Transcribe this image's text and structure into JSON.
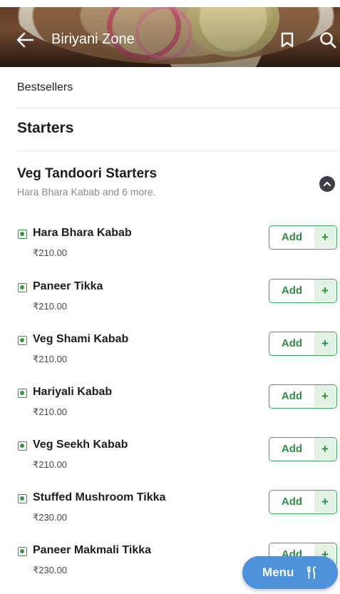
{
  "header": {
    "title": "Biriyani Zone",
    "back_icon": "arrow-left-icon",
    "bookmark_icon": "bookmark-icon",
    "search_icon": "search-icon"
  },
  "nav": {
    "bestsellers": "Bestsellers",
    "starters": "Starters"
  },
  "category": {
    "title": "Veg Tandoori Starters",
    "subtitle": "Hara Bhara Kabab and 6 more.",
    "toggle_icon": "chevron-up-icon"
  },
  "items": [
    {
      "name": "Hara Bhara Kabab",
      "price": "₹210.00",
      "add_label": "Add",
      "plus": "+"
    },
    {
      "name": "Paneer Tikka",
      "price": "₹210.00",
      "add_label": "Add",
      "plus": "+"
    },
    {
      "name": "Veg Shami Kabab",
      "price": "₹210.00",
      "add_label": "Add",
      "plus": "+"
    },
    {
      "name": "Hariyali Kabab",
      "price": "₹210.00",
      "add_label": "Add",
      "plus": "+"
    },
    {
      "name": "Veg Seekh Kabab",
      "price": "₹210.00",
      "add_label": "Add",
      "plus": "+"
    },
    {
      "name": "Stuffed Mushroom Tikka",
      "price": "₹230.00",
      "add_label": "Add",
      "plus": "+"
    },
    {
      "name": "Paneer Makmali Tikka",
      "price": "₹230.00",
      "add_label": "Add",
      "plus": "+"
    }
  ],
  "fab": {
    "label": "Menu",
    "icon": "fork-knife-icon"
  },
  "colors": {
    "veg_green": "#2e9c3a",
    "add_green": "#2f8d45",
    "fab_blue": "#4e92dc"
  }
}
